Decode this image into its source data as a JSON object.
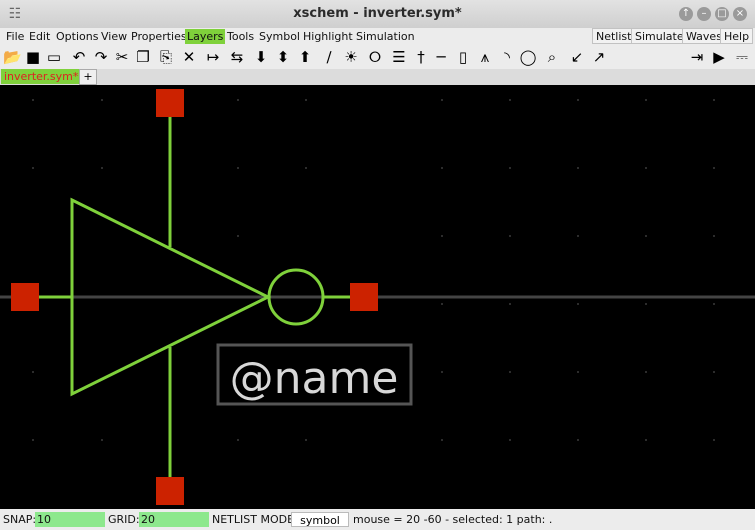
{
  "window": {
    "title": "xschem - inverter.sym*",
    "app_icon": "grid-icon"
  },
  "menu": {
    "left": [
      "File",
      "Edit",
      "Options",
      "View",
      "Properties",
      "Layers",
      "Tools",
      "Symbol",
      "Highlight",
      "Simulation"
    ],
    "active": "Layers",
    "right": [
      "Netlist",
      "Simulate",
      "Waves",
      "Help"
    ]
  },
  "toolbar": {
    "icons": [
      "open",
      "save",
      "reload",
      "undo",
      "redo",
      "cut",
      "copy",
      "paste",
      "delete",
      "move",
      "swap",
      "push",
      "pull",
      "pop",
      "pen",
      "lamp",
      "gate",
      "text",
      "pin",
      "line",
      "rect",
      "polygon",
      "arc",
      "circle",
      "zoom",
      "zoom-in",
      "zoom-out",
      "netlist-out",
      "play",
      "waveform"
    ]
  },
  "tabs": {
    "items": [
      "inverter.sym*"
    ],
    "add_label": "+"
  },
  "canvas": {
    "name_label": "@name",
    "colors": {
      "wire": "#7fd13b",
      "pin": "#cc2200",
      "axis": "#444444",
      "background": "#000000"
    }
  },
  "status": {
    "snap_label": "SNAP:",
    "snap_value": "10",
    "grid_label": "GRID:",
    "grid_value": "20",
    "netlist_label": "NETLIST MODE:",
    "netlist_value": "symbol",
    "mouse_text": "mouse = 20 -60 - selected: 1 path: ."
  }
}
